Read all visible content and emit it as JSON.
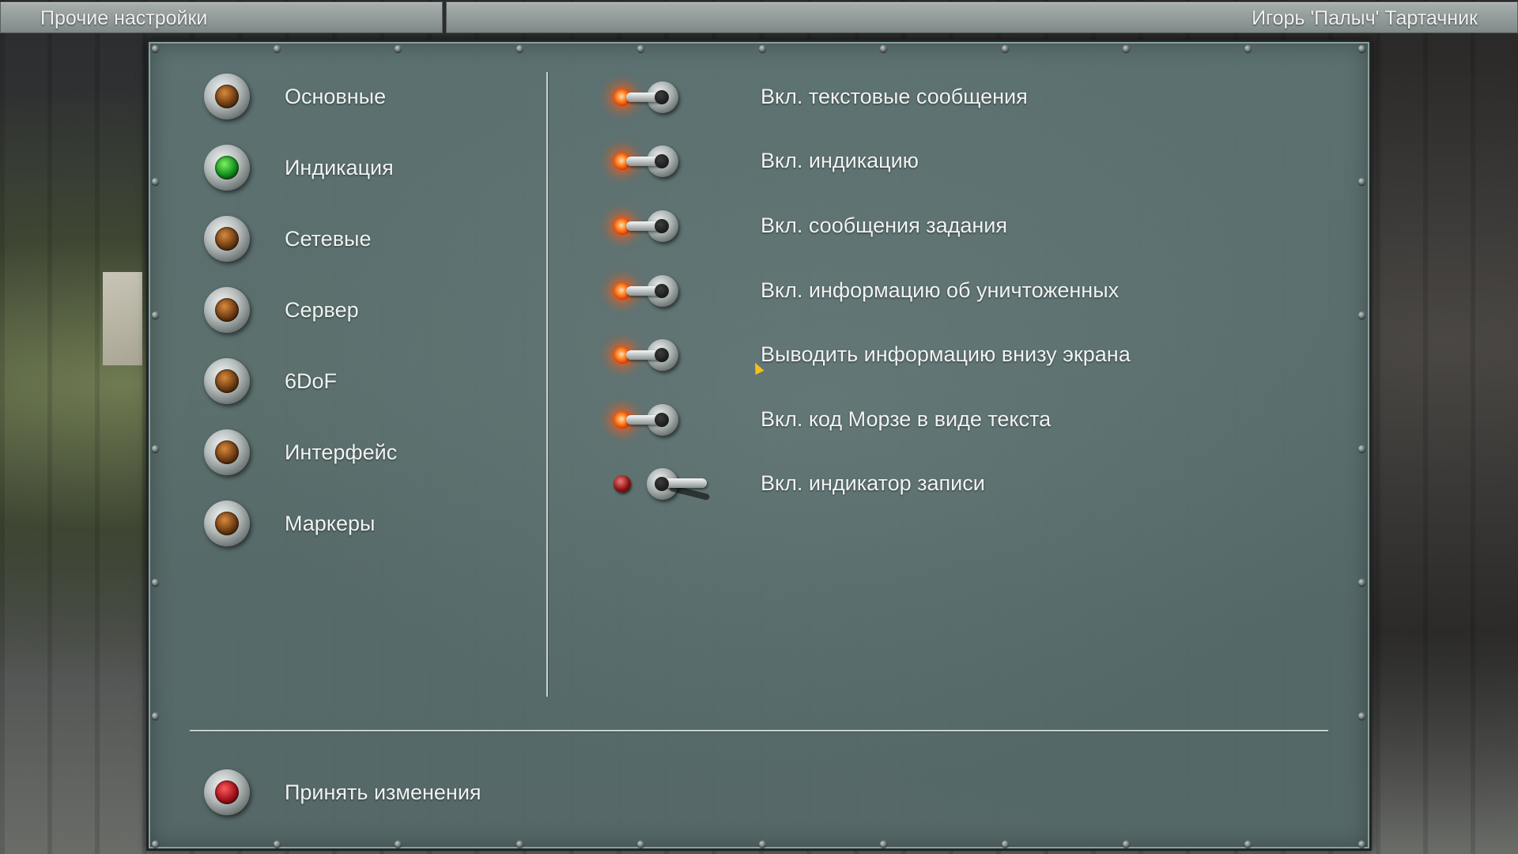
{
  "header": {
    "left_title": "Прочие настройки",
    "right_title": "Игорь 'Палыч' Тартачник"
  },
  "menu": {
    "items": [
      {
        "label": "Основные",
        "lamp": "amber"
      },
      {
        "label": "Индикация",
        "lamp": "green"
      },
      {
        "label": "Сетевые",
        "lamp": "amber"
      },
      {
        "label": "Сервер",
        "lamp": "amber"
      },
      {
        "label": "6DoF",
        "lamp": "amber"
      },
      {
        "label": "Интерфейс",
        "lamp": "amber"
      },
      {
        "label": "Маркеры",
        "lamp": "amber"
      }
    ]
  },
  "options": {
    "items": [
      {
        "label": "Вкл. текстовые сообщения",
        "state": "on"
      },
      {
        "label": "Вкл. индикацию",
        "state": "on"
      },
      {
        "label": "Вкл. сообщения задания",
        "state": "on"
      },
      {
        "label": "Вкл. информацию об уничтоженных",
        "state": "on"
      },
      {
        "label": "Выводить информацию внизу экрана",
        "state": "on"
      },
      {
        "label": "Вкл. код Морзе в виде текста",
        "state": "on"
      },
      {
        "label": "Вкл. индикатор записи",
        "state": "off"
      }
    ]
  },
  "footer": {
    "apply_label": "Принять изменения",
    "apply_lamp": "red"
  },
  "colors": {
    "panel": "#5f7676",
    "led_on": "#ff5a14",
    "lamp_active": "#21b02e"
  }
}
